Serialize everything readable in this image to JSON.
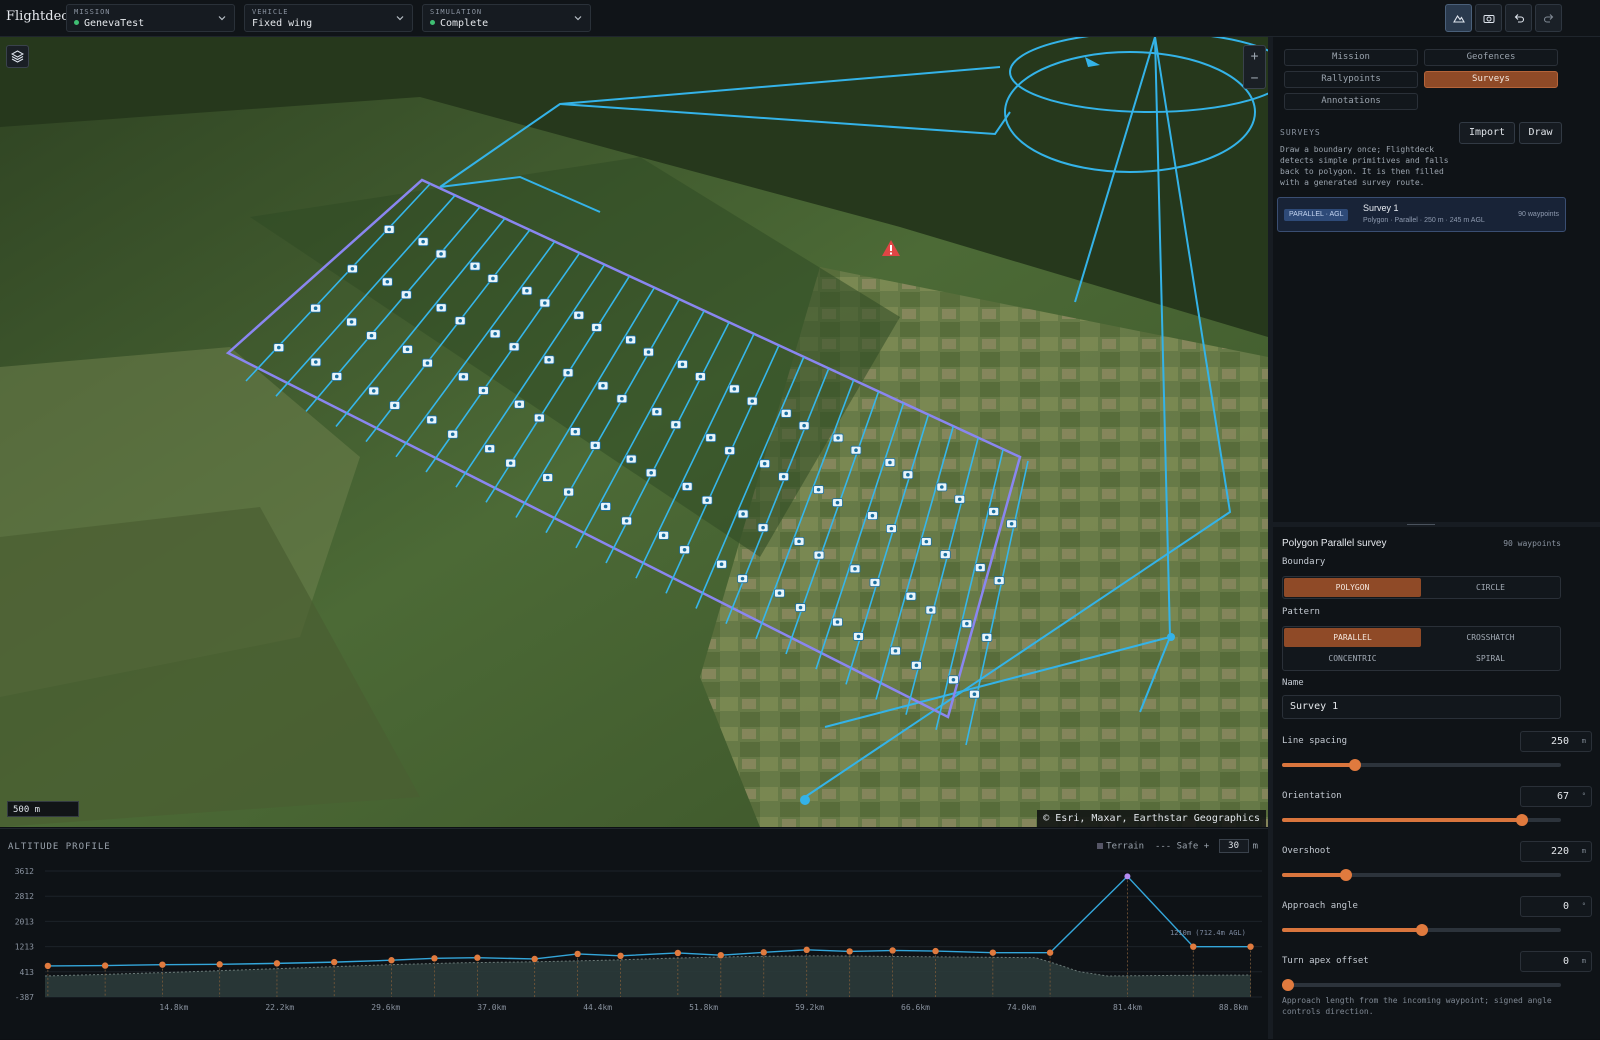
{
  "topbar": {
    "brand": "Flightdeck",
    "mission": {
      "caption": "MISSION",
      "value": "GenevaTest"
    },
    "vehicle": {
      "caption": "VEHICLE",
      "value": "Fixed wing"
    },
    "simulation": {
      "caption": "SIMULATION",
      "value": "Complete"
    },
    "buttons": [
      "terrain-icon",
      "camera-icon",
      "undo-icon",
      "redo-icon"
    ]
  },
  "map": {
    "scale": "500 m",
    "attribution": "© Esri, Maxar, Earthstar Geographics",
    "zoom_in": "+",
    "zoom_out": "−"
  },
  "panel": {
    "tabs": [
      "Mission",
      "Geofences",
      "Rallypoints",
      "Surveys",
      "Annotations"
    ],
    "active_tab": "Surveys",
    "surveys_heading": "SURVEYS",
    "import_label": "Import",
    "draw_label": "Draw",
    "description": "Draw a boundary once; Flightdeck detects simple primitives and falls back to polygon. It is then filled with a generated survey route.",
    "survey": {
      "badge": "PARALLEL · AGL",
      "name": "Survey 1",
      "details": "Polygon · Parallel · 250 m · 245 m AGL",
      "waypoints": "90 waypoints"
    },
    "editor": {
      "title": "Polygon Parallel survey",
      "waypoints": "90 waypoints",
      "boundary_label": "Boundary",
      "boundary_options": [
        "POLYGON",
        "CIRCLE"
      ],
      "boundary_selected": "POLYGON",
      "pattern_label": "Pattern",
      "pattern_options": [
        "PARALLEL",
        "CROSSHATCH",
        "CONCENTRIC",
        "SPIRAL"
      ],
      "pattern_selected": "PARALLEL",
      "name_label": "Name",
      "name_value": "Survey 1",
      "line_spacing": {
        "label": "Line spacing",
        "value": "250",
        "unit": "m",
        "fraction": 0.26
      },
      "orientation": {
        "label": "Orientation",
        "value": "67",
        "unit": "°",
        "fraction": 0.86
      },
      "overshoot": {
        "label": "Overshoot",
        "value": "220",
        "unit": "m",
        "fraction": 0.23
      },
      "approach_angle": {
        "label": "Approach angle",
        "value": "0",
        "unit": "°",
        "fraction": 0.5
      },
      "turn_apex_offset": {
        "label": "Turn apex offset",
        "value": "0",
        "unit": "m",
        "fraction": 0.02
      },
      "help": "Approach length from the incoming waypoint; signed angle controls direction."
    }
  },
  "altitude": {
    "title": "ALTITUDE PROFILE",
    "legend_terrain": "Terrain",
    "legend_safe": "Safe +",
    "safe_value": "30",
    "safe_unit": "m",
    "peak_label": "1210m (712.4m AGL)"
  },
  "chart_data": {
    "type": "line",
    "title": "ALTITUDE PROFILE",
    "xlabel": "",
    "ylabel": "",
    "x_ticks": [
      "14.8km",
      "22.2km",
      "29.6km",
      "37.0km",
      "44.4km",
      "51.8km",
      "59.2km",
      "66.6km",
      "74.0km",
      "81.4km",
      "88.8km"
    ],
    "y_ticks": [
      "3612",
      "2812",
      "2013",
      "1213",
      "413",
      "-387"
    ],
    "ylim": [
      -387,
      3612
    ],
    "xlim": [
      5.8,
      90.8
    ],
    "series": [
      {
        "name": "Terrain",
        "x": [
          5.8,
          10,
          15,
          20,
          25,
          30,
          35,
          40,
          45,
          50,
          55,
          60,
          65,
          70,
          75,
          76.5,
          78,
          80,
          85,
          90
        ],
        "y": [
          280,
          330,
          400,
          480,
          560,
          640,
          700,
          730,
          780,
          850,
          900,
          920,
          900,
          880,
          860,
          650,
          420,
          280,
          300,
          310
        ]
      },
      {
        "x": [
          6,
          10,
          14,
          18,
          22,
          26,
          30,
          33,
          36,
          40,
          43,
          46,
          50,
          53,
          56,
          59,
          62,
          65,
          68,
          72,
          76,
          81.4,
          86,
          90
        ],
        "y": [
          600,
          610,
          640,
          650,
          680,
          720,
          780,
          840,
          860,
          820,
          980,
          920,
          1010,
          940,
          1030,
          1110,
          1060,
          1090,
          1070,
          1020,
          1020,
          3440,
          1210,
          1210
        ]
      }
    ]
  }
}
